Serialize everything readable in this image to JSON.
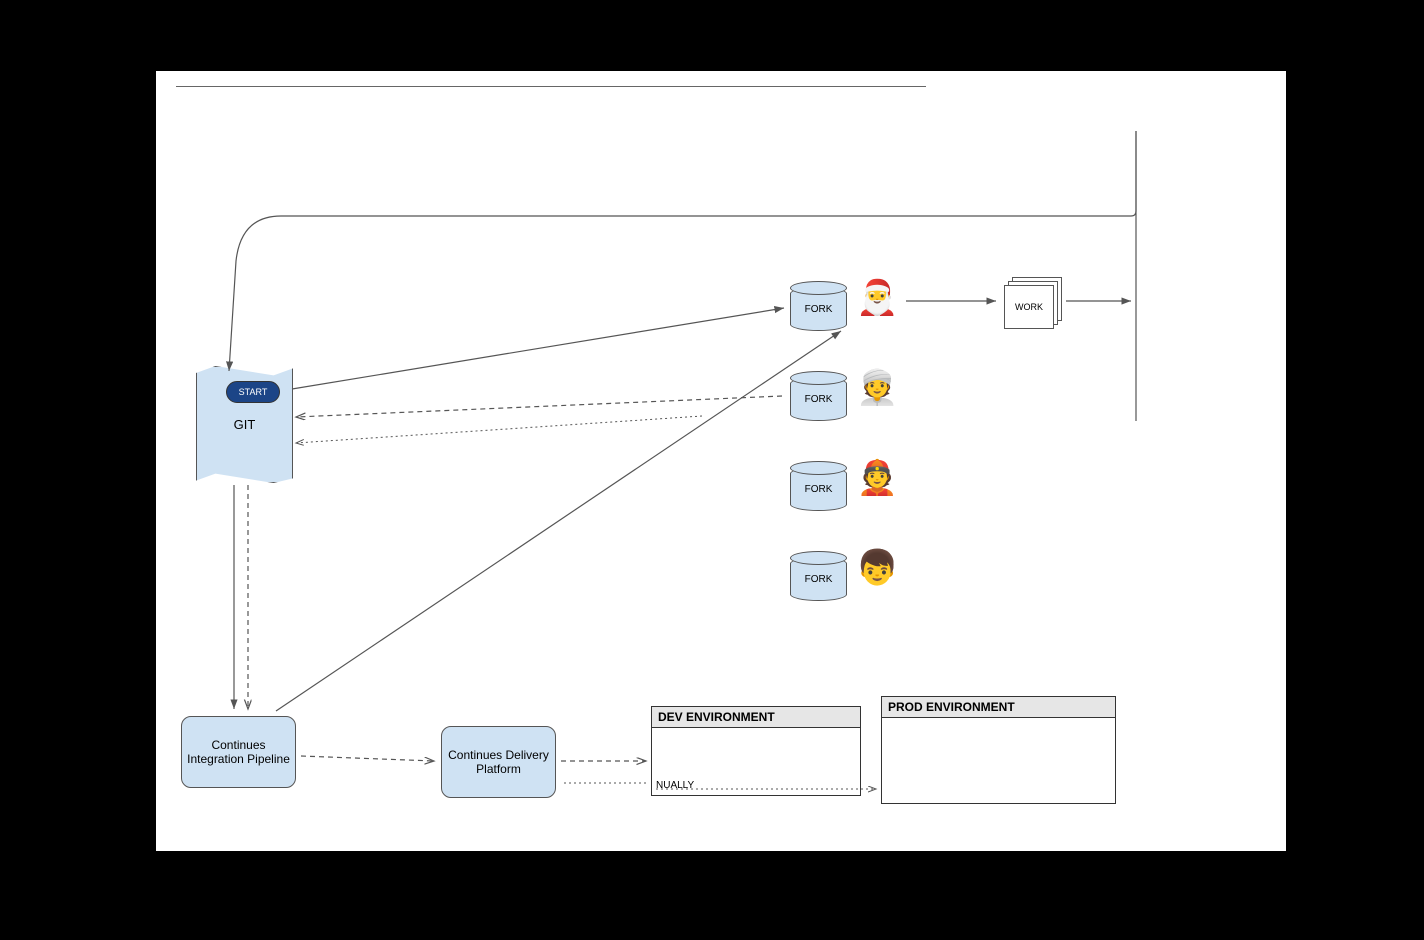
{
  "git_label": "GIT",
  "start_label": "START",
  "fork_label": "FORK",
  "work_label": "WORK",
  "ci_label": "Continues Integration Pipeline",
  "cd_label": "Continues Delivery Platform",
  "dev_env_label": "DEV ENVIRONMENT",
  "prod_env_label": "PROD ENVIRONMENT",
  "manual_text": "NUALLY",
  "avatars": {
    "santa": "🎅",
    "turban": "👳",
    "worker": "👲",
    "person": "👦"
  }
}
